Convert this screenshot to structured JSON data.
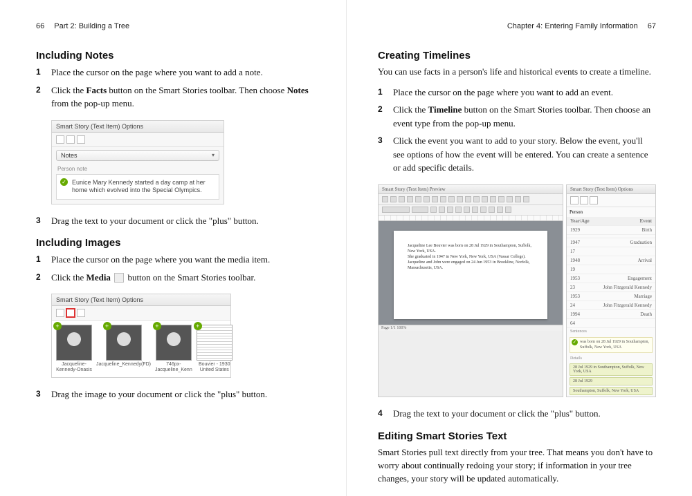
{
  "left": {
    "page_number": "66",
    "running_head": "Part 2: Building a Tree",
    "h_notes": "Including Notes",
    "notes_steps": [
      "Place the cursor on the page where you want to add a note.",
      "Click the <b>Facts</b> button on the Smart Stories toolbar. Then choose <b>Notes</b> from the pop-up menu.",
      "Drag the text to your document or click the \"plus\" button."
    ],
    "fig1": {
      "title": "Smart Story (Text Item) Options",
      "dropdown": "Notes",
      "section": "Person note",
      "note_text": "Eunice Mary Kennedy started a day camp at her home which evolved into the Special Olympics."
    },
    "h_images": "Including Images",
    "images_steps": [
      "Place the cursor on the page where you want the media item.",
      "Click the <b>Media</b> <span class=\"inline-icon\" data-name=\"media-icon\" data-interactable=\"false\"></span> button on the Smart Stories toolbar.",
      "Drag the image to your document or click the \"plus\" button."
    ],
    "fig2": {
      "title": "Smart Story (Text Item) Options",
      "thumbs": [
        "Jacqueline-Kennedy-Onasis",
        "Jacqueline_Kennedy(FD)",
        "746px-Jacqueline_Kenn",
        "Bouvier - 1930 United States"
      ]
    }
  },
  "right": {
    "page_number": "67",
    "running_head": "Chapter 4: Entering Family Information",
    "h_timelines": "Creating Timelines",
    "intro": "You can use facts in a person's life and historical events to create a timeline.",
    "timeline_steps": [
      "Place the cursor on the page where you want to add an event.",
      "Click the <b>Timeline</b> button on the Smart Stories toolbar. Then choose an event type from the pop-up menu.",
      "Click the event you want to add to your story. Below the event, you'll see options of how the event will be entered. You can create a sentence or add specific details.",
      "Drag the text to your document or click the \"plus\" button."
    ],
    "bigfig": {
      "preview_title": "Smart Story (Text Item) Preview",
      "paper_lines": [
        "Jacqueline Lee Bouvier was born on 28 Jul 1929 in Southampton, Suffolk, New York, USA.",
        "She graduated in 1947 in New York, New York, USA (Vassar College).",
        "Jacqueline and John were engaged on 24 Jun 1953 in Brookline, Norfolk, Massachusetts, USA."
      ],
      "status": "Page 1/1  100%",
      "options_title": "Smart Story (Text Item) Options",
      "dropdown": "Person",
      "table_header": [
        "Year/Age",
        "Event"
      ],
      "rows": [
        [
          "1929",
          "Birth"
        ],
        [
          "",
          ""
        ],
        [
          "1947",
          "Graduation"
        ],
        [
          "17",
          ""
        ],
        [
          "1948",
          "Arrival"
        ],
        [
          "19",
          ""
        ],
        [
          "1953",
          "Engagement"
        ],
        [
          "23",
          "John Fitzgerald Kennedy"
        ],
        [
          "1953",
          "Marriage"
        ],
        [
          "24",
          "John Fitzgerald Kennedy"
        ],
        [
          "1994",
          "Death"
        ],
        [
          "64",
          ""
        ]
      ],
      "sentence": "was born on 28 Jul 1929 in Southampton, Suffolk, New York, USA",
      "details": [
        "28 Jul 1929 in Southampton, Suffolk, New York, USA",
        "28 Jul 1929",
        "Southampton, Suffolk, New York, USA"
      ]
    },
    "h_editing": "Editing Smart Stories Text",
    "editing_body": "Smart Stories pull text directly from your tree. That means you don't have to worry about continually redoing your story; if information in your tree changes, your story will be updated automatically."
  }
}
